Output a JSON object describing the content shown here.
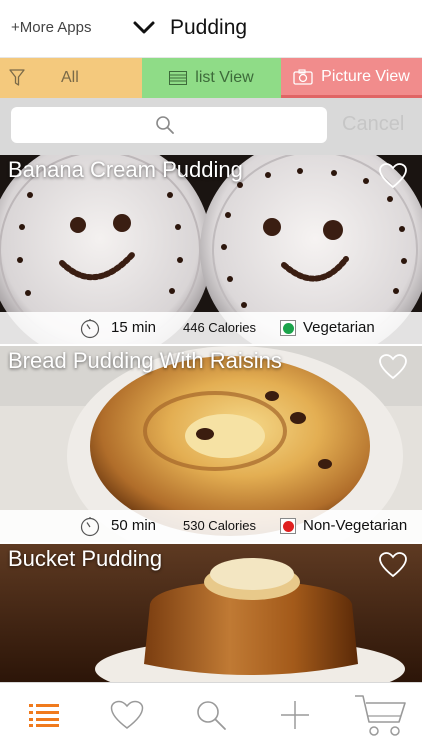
{
  "header": {
    "more_apps": "+More Apps",
    "title": "Pudding"
  },
  "filters": {
    "all": "All",
    "list_view": "list View",
    "picture_view": "Picture View"
  },
  "search": {
    "placeholder": "",
    "cancel": "Cancel"
  },
  "recipes": [
    {
      "name": "Banana Cream Pudding",
      "time": "15 min",
      "calories": "446 Calories",
      "diet": "Vegetarian",
      "diet_color": "#1aa34a"
    },
    {
      "name": "Bread Pudding With Raisins",
      "time": "50 min",
      "calories": "530 Calories",
      "diet": "Non-Vegetarian",
      "diet_color": "#e02020"
    },
    {
      "name": "Bucket Pudding"
    }
  ],
  "tabbar": {
    "items": [
      "list-icon",
      "heart-icon",
      "search-icon",
      "add-icon",
      "cart-icon"
    ],
    "active_color": "#f07a1d",
    "inactive_color": "#9a9a9a"
  }
}
